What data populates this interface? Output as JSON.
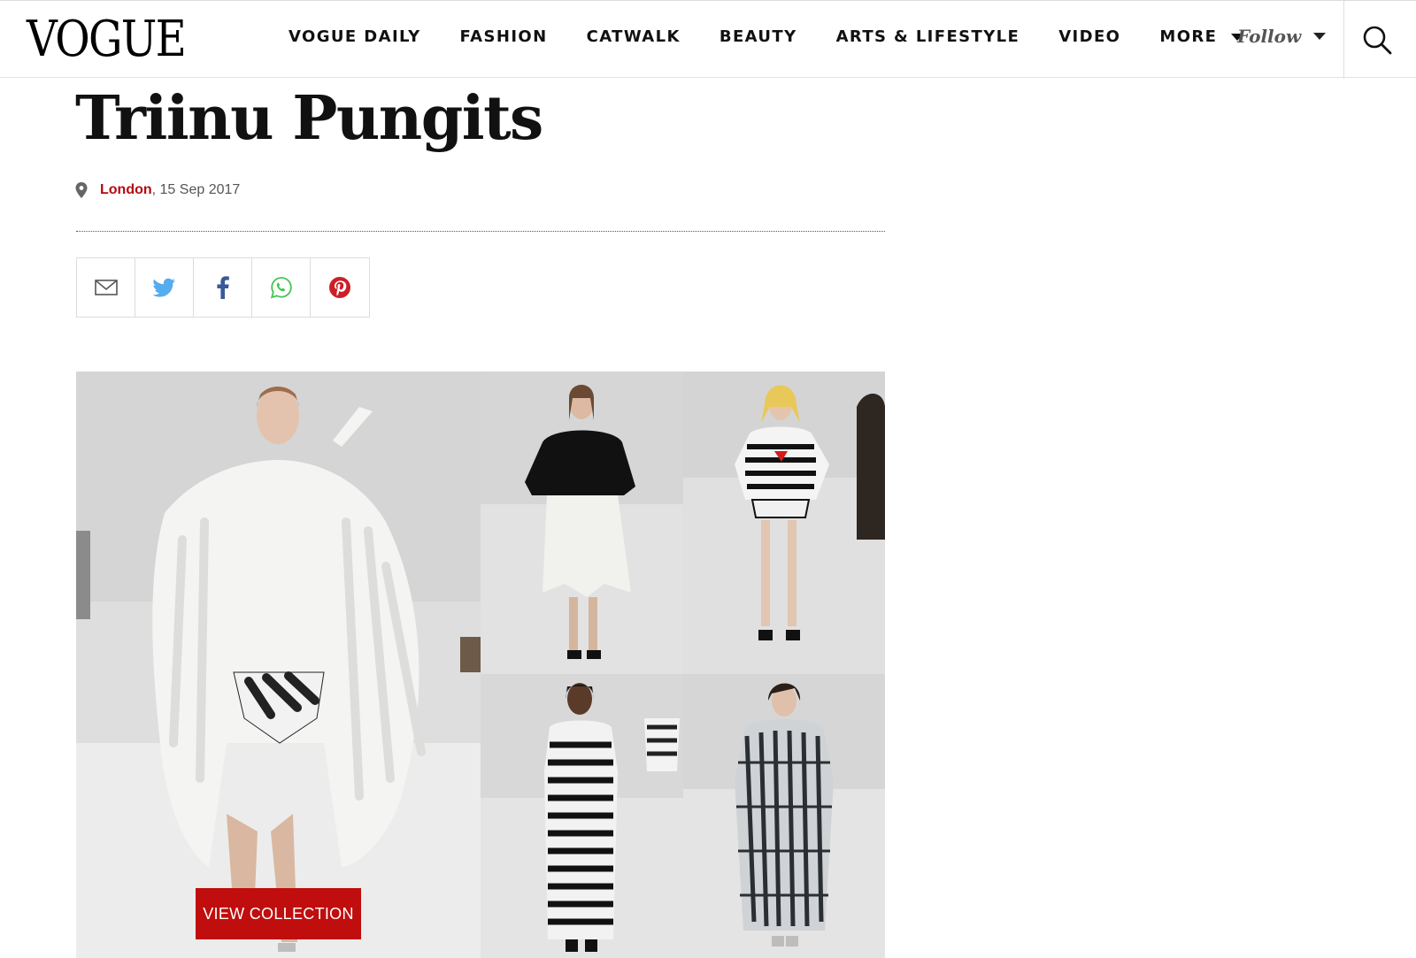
{
  "header": {
    "logo": "VOGUE",
    "nav": [
      {
        "label": "VOGUE DAILY"
      },
      {
        "label": "FASHION"
      },
      {
        "label": "CATWALK"
      },
      {
        "label": "BEAUTY"
      },
      {
        "label": "ARTS & LIFESTYLE"
      },
      {
        "label": "VIDEO"
      },
      {
        "label": "MORE"
      }
    ],
    "follow_label": "Follow"
  },
  "article": {
    "title": "Triinu Pungits",
    "location": "London",
    "date": ", 15 Sep 2017"
  },
  "share": [
    "mail-icon",
    "twitter-icon",
    "facebook-icon",
    "whatsapp-icon",
    "pinterest-icon"
  ],
  "gallery": {
    "button_label": "VIEW COLLECTION"
  },
  "colors": {
    "accent": "#c00d0d",
    "location": "#b5090f",
    "twitter": "#55acee",
    "facebook": "#3b5998",
    "whatsapp": "#43c553",
    "pinterest": "#cb2027"
  }
}
